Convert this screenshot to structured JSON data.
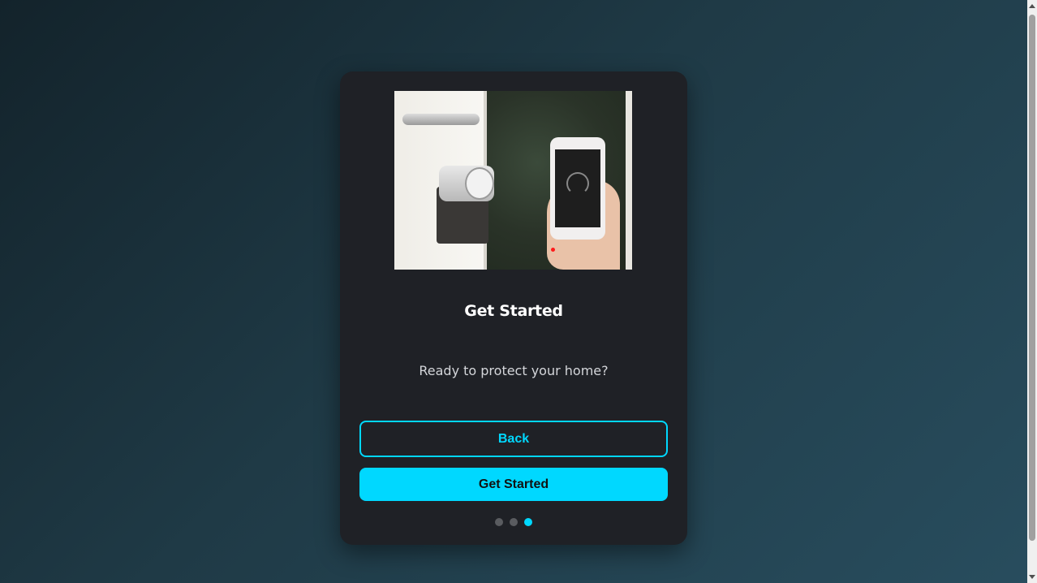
{
  "onboarding": {
    "image_alt": "Smart lock on door controlled by smartphone",
    "title": "Get Started",
    "subtitle": "Ready to protect your home?",
    "back_label": "Back",
    "primary_label": "Get Started",
    "steps_total": 3,
    "current_step": 3
  },
  "colors": {
    "accent": "#00d8ff",
    "card": "#1f2126",
    "dot_inactive": "#5a5c60"
  }
}
